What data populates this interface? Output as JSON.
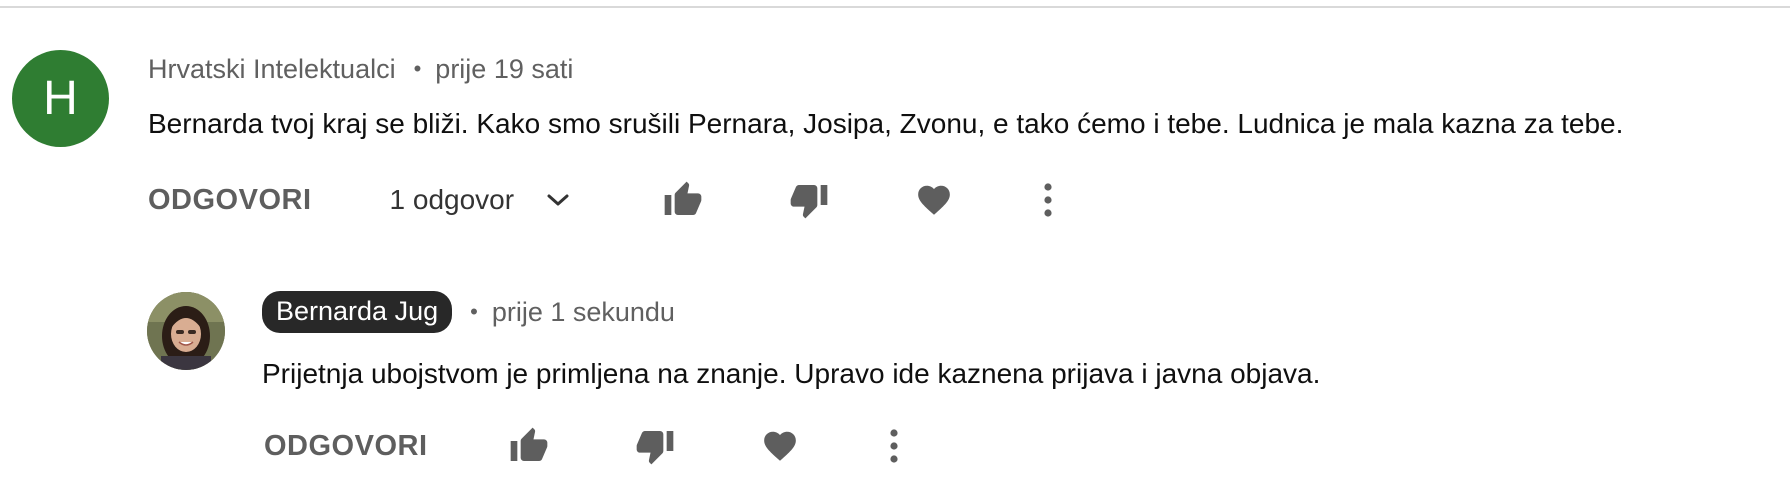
{
  "comment": {
    "avatar_letter": "H",
    "avatar_color": "#2f7d32",
    "author": "Hrvatski Intelektualci",
    "separator": "•",
    "time": "prije 19 sati",
    "text": "Bernarda tvoj kraj se bliži. Kako smo srušili Pernara, Josipa, Zvonu, e tako ćemo i tebe. Ludnica je mala kazna za tebe.",
    "reply_label": "ODGOVORI",
    "replies_label": "1 odgovor",
    "icons": [
      "thumbs-up-icon",
      "thumbs-down-icon",
      "heart-icon",
      "more-vert-icon"
    ]
  },
  "reply": {
    "author": "Bernarda Jug",
    "separator": "•",
    "time": "prije 1 sekundu",
    "text": "Prijetnja ubojstvom je primljena na znanje. Upravo ide kaznena prijava i javna objava.",
    "reply_label": "ODGOVORI",
    "icons": [
      "thumbs-up-icon",
      "thumbs-down-icon",
      "heart-icon",
      "more-vert-icon"
    ]
  },
  "colors": {
    "icon": "#5e5e5e",
    "owner_badge_bg": "#282828",
    "meta_text": "#606060"
  }
}
